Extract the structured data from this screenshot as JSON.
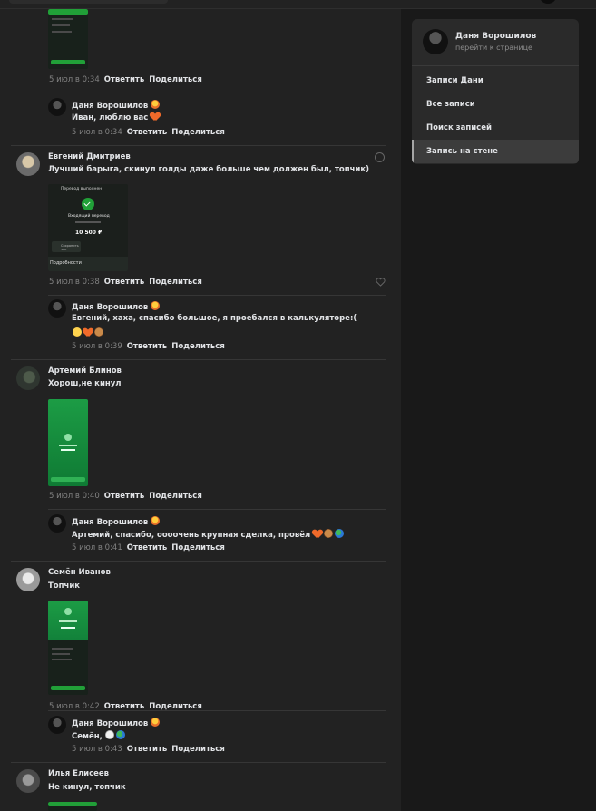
{
  "right_panel": {
    "profile_name": "Даня Ворошилов",
    "profile_link": "перейти к странице",
    "menu": [
      "Записи Дани",
      "Все записи",
      "Поиск записей",
      "Запись на стене"
    ]
  },
  "actions": {
    "reply": "Ответить",
    "share": "Поделиться"
  },
  "comments": [
    {
      "time": "5 июл в 0:34"
    },
    {
      "author": "Даня Ворошилов",
      "text": "Иван, люблю вас",
      "time": "5 июл в 0:34"
    },
    {
      "author": "Евгений Дмитриев",
      "text": "Лучший барыга, скинул голды даже больше чем должен был, топчик)",
      "time": "5 июл в 0:38",
      "image": {
        "header": "Перевод выполнен",
        "status": "Входящий перевод",
        "amount": "10 500 ₽",
        "button": "Сохранить чек",
        "footer": "Подробности"
      }
    },
    {
      "author": "Даня Ворошилов",
      "text": "Евгений, хаха, спасибо большое, я проебался в калькуляторе:(",
      "time": "5 июл в 0:39"
    },
    {
      "author": "Артемий Блинов",
      "text": "Хорош,не кинул",
      "time": "5 июл в 0:40"
    },
    {
      "author": "Даня Ворошилов",
      "text": "Артемий, спасибо, оооочень крупная сделка, провёл",
      "time": "5 июл в 0:41"
    },
    {
      "author": "Семён Иванов",
      "text": "Топчик",
      "time": "5 июл в 0:42"
    },
    {
      "author": "Даня Ворошилов",
      "text": "Семён,",
      "time": "5 июл в 0:43"
    },
    {
      "author": "Илья Елисеев",
      "text": "Не кинул, топчик"
    }
  ],
  "colors": {
    "feed_bg": "#222222",
    "page_bg": "#191919",
    "accent_green": "#21a038"
  },
  "icons": [
    "fire-emoji",
    "heart-emoji",
    "laugh-emoji",
    "bear-emoji",
    "globe-emoji",
    "dove-emoji",
    "like-heart-icon",
    "info-icon"
  ]
}
